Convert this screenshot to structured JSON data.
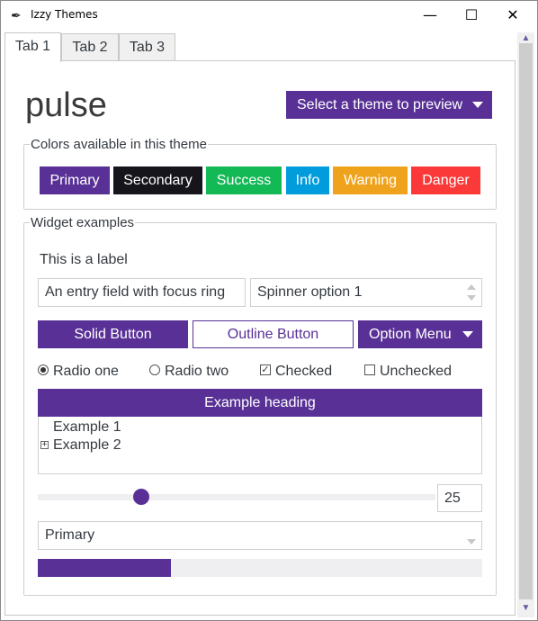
{
  "window": {
    "title": "Izzy Themes",
    "app_icon": "feather-icon",
    "controls": {
      "minimize": "—",
      "maximize": "☐",
      "close": "✕"
    }
  },
  "tabs": [
    {
      "label": "Tab 1",
      "active": true
    },
    {
      "label": "Tab 2",
      "active": false
    },
    {
      "label": "Tab 3",
      "active": false
    }
  ],
  "header": {
    "theme_name": "pulse",
    "theme_select_label": "Select a theme to preview"
  },
  "colors_group": {
    "legend": "Colors available in this theme",
    "swatches": [
      {
        "label": "Primary",
        "color": "#593196"
      },
      {
        "label": "Secondary",
        "color": "#16151b"
      },
      {
        "label": "Success",
        "color": "#13b955"
      },
      {
        "label": "Info",
        "color": "#009cdc"
      },
      {
        "label": "Warning",
        "color": "#efa31d"
      },
      {
        "label": "Danger",
        "color": "#fc3939"
      }
    ]
  },
  "widgets_group": {
    "legend": "Widget examples",
    "label": "This is a label",
    "entry_value": "An entry field with focus ring",
    "spinner_value": "Spinner option 1",
    "solid_button": "Solid Button",
    "outline_button": "Outline Button",
    "option_menu": "Option Menu",
    "radio_one": {
      "label": "Radio one",
      "checked": true
    },
    "radio_two": {
      "label": "Radio two",
      "checked": false
    },
    "check_one": {
      "label": "Checked",
      "checked": true
    },
    "check_two": {
      "label": "Unchecked",
      "checked": false
    },
    "tree": {
      "heading": "Example heading",
      "items": [
        {
          "label": "Example 1",
          "expandable": false
        },
        {
          "label": "Example 2",
          "expandable": true
        }
      ]
    },
    "scale": {
      "value": 25,
      "min": 0,
      "max": 100
    },
    "scale_value_text": "25",
    "combobox_value": "Primary",
    "progress": {
      "value": 0.3
    }
  },
  "accent_color": "#593196"
}
